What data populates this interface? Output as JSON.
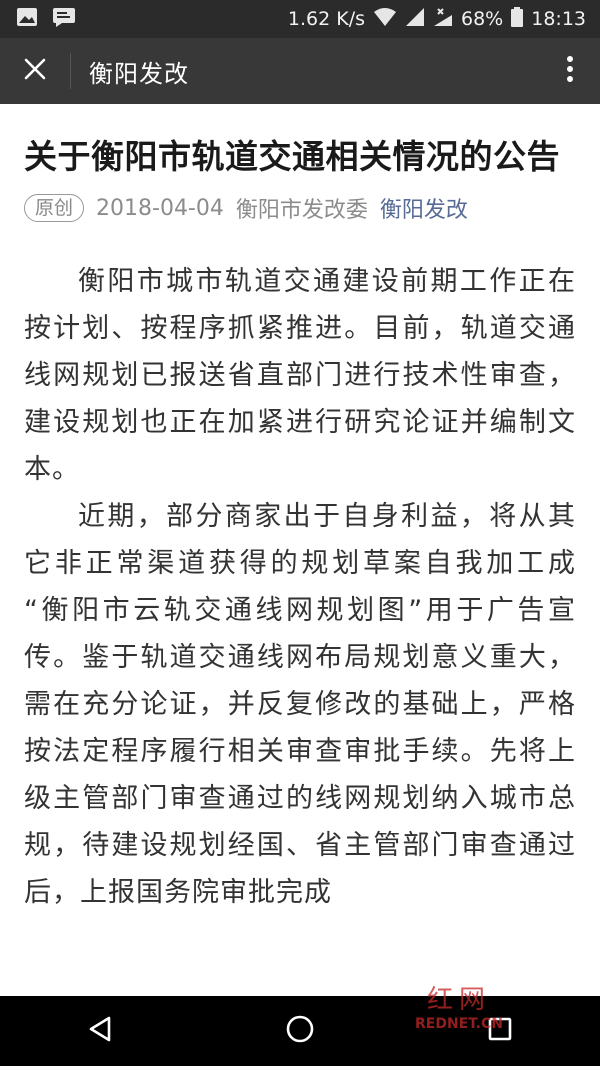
{
  "status_bar": {
    "network_speed": "1.62 K/s",
    "battery_percent": "68%",
    "time": "18:13",
    "icons": [
      "image-icon",
      "notification-icon",
      "wifi-icon",
      "signal-icon",
      "signal-x-icon",
      "battery-icon"
    ]
  },
  "app_bar": {
    "title": "衡阳发改",
    "close_icon": "close-icon",
    "more_icon": "more-vertical-icon"
  },
  "article": {
    "title": "关于衡阳市轨道交通相关情况的公告",
    "badge": "原创",
    "date": "2018-04-04",
    "author": "衡阳市发改委",
    "account": "衡阳发改",
    "paragraphs": [
      "衡阳市城市轨道交通建设前期工作正在按计划、按程序抓紧推进。目前，轨道交通线网规划已报送省直部门进行技术性审查，建设规划也正在加紧进行研究论证并编制文本。",
      "近期，部分商家出于自身利益，将从其它非正常渠道获得的规划草案自我加工成 “衡阳市云轨交通线网规划图”用于广告宣传。鉴于轨道交通线网布局规划意义重大，需在充分论证，并反复修改的基础上，严格按法定程序履行相关审查审批手续。先将上级主管部门审查通过的线网规划纳入城市总规，待建设规划经国、省主管部门审查通过后，上报国务院审批完成"
    ]
  },
  "watermark": {
    "main": "红网",
    "sub": "REDNET.CN"
  },
  "nav_bar": {
    "icons": [
      "back-triangle-icon",
      "home-circle-icon",
      "recents-square-icon"
    ]
  }
}
